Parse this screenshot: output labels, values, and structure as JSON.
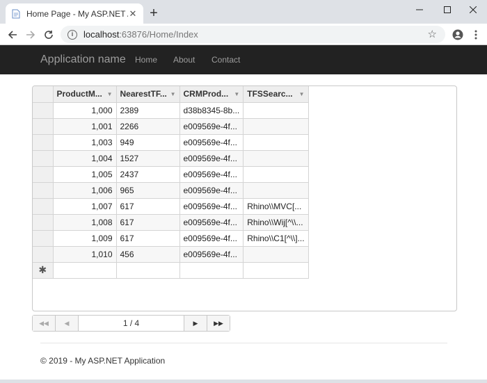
{
  "browser": {
    "tab_title": "Home Page - My ASP.NET Applic",
    "new_tab": "+",
    "url_host": "localhost",
    "url_rest": ":63876/Home/Index"
  },
  "navbar": {
    "brand": "Application name",
    "links": [
      "Home",
      "About",
      "Contact"
    ]
  },
  "grid": {
    "columns": [
      "ProductM...",
      "NearestTF...",
      "CRMProd...",
      "TFSSearc..."
    ],
    "rows": [
      [
        "1,000",
        "2389",
        "d38b8345-8b...",
        ""
      ],
      [
        "1,001",
        "2266",
        "e009569e-4f...",
        ""
      ],
      [
        "1,003",
        "949",
        "e009569e-4f...",
        ""
      ],
      [
        "1,004",
        "1527",
        "e009569e-4f...",
        ""
      ],
      [
        "1,005",
        "2437",
        "e009569e-4f...",
        ""
      ],
      [
        "1,006",
        "965",
        "e009569e-4f...",
        ""
      ],
      [
        "1,007",
        "617",
        "e009569e-4f...",
        "Rhino\\\\MVC[..."
      ],
      [
        "1,008",
        "617",
        "e009569e-4f...",
        "Rhino\\\\Wij[^\\\\..."
      ],
      [
        "1,009",
        "617",
        "e009569e-4f...",
        "Rhino\\\\C1[^\\\\]..."
      ],
      [
        "1,010",
        "456",
        "e009569e-4f...",
        ""
      ]
    ],
    "new_row_marker": "✱"
  },
  "pager": {
    "info": "1 / 4"
  },
  "footer": {
    "text": "© 2019 - My ASP.NET Application"
  }
}
